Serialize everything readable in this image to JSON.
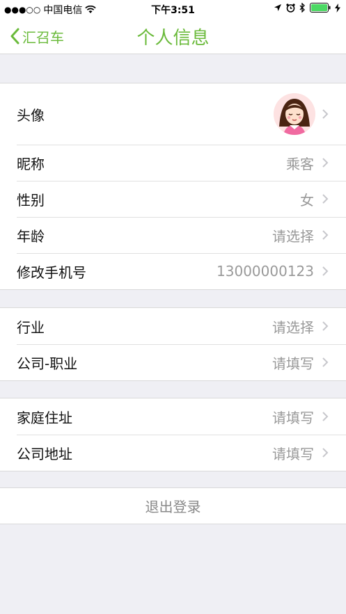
{
  "status_bar": {
    "signal": "●●●○○",
    "carrier": "中国电信",
    "time": "下午3:51",
    "battery_color": "#4cd964"
  },
  "nav": {
    "back_label": "汇召车",
    "title": "个人信息",
    "accent_color": "#6aba3a"
  },
  "profile": {
    "avatar_label": "头像",
    "nickname_label": "昵称",
    "nickname_value": "乘客",
    "gender_label": "性别",
    "gender_value": "女",
    "age_label": "年龄",
    "age_value": "请选择",
    "phone_label": "修改手机号",
    "phone_value": "13000000123"
  },
  "work": {
    "industry_label": "行业",
    "industry_value": "请选择",
    "company_label": "公司-职业",
    "company_value": "请填写"
  },
  "address": {
    "home_label": "家庭住址",
    "home_value": "请填写",
    "office_label": "公司地址",
    "office_value": "请填写"
  },
  "logout_label": "退出登录"
}
